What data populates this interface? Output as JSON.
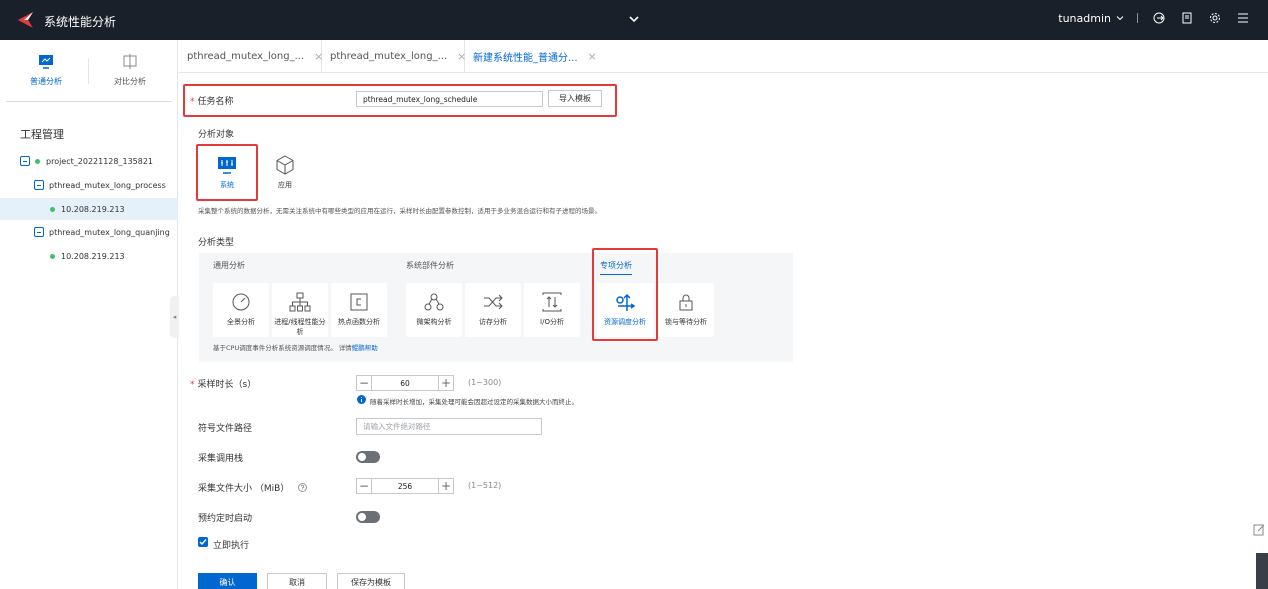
{
  "header": {
    "app_title": "系统性能分析",
    "username": "tunadmin"
  },
  "sidebar": {
    "mode_tabs": [
      {
        "label": "普通分析"
      },
      {
        "label": "对比分析"
      }
    ],
    "project_title": "工程管理",
    "tree": [
      {
        "label": "project_20221128_135821"
      },
      {
        "label": "pthread_mutex_long_process"
      },
      {
        "label": "10.208.219.213"
      },
      {
        "label": "pthread_mutex_long_quanjing"
      },
      {
        "label": "10.208.219.213"
      }
    ]
  },
  "tabs": [
    {
      "label": "pthread_mutex_long_...",
      "close": "×"
    },
    {
      "label": "pthread_mutex_long_...",
      "close": "×"
    },
    {
      "label": "新建系统性能_普通分...",
      "close": "×"
    }
  ],
  "form": {
    "task_name_label": "任务名称",
    "task_name_value": "pthread_mutex_long_schedule",
    "import_template": "导入模板",
    "target_label": "分析对象",
    "targets": [
      {
        "label": "系统"
      },
      {
        "label": "应用"
      }
    ],
    "target_desc": "采集整个系统的数据分析，无需关注系统中有哪些类型的应用在运行，采样时长由配置参数控制，适用于多业务混合运行和有子进程的场景。",
    "type_label": "分析类型",
    "groups": [
      {
        "label": "通用分析"
      },
      {
        "label": "系统部件分析"
      },
      {
        "label": "专项分析"
      }
    ],
    "types": [
      {
        "label": "全景分析"
      },
      {
        "label": "进程/线程性能分析"
      },
      {
        "label": "热点函数分析"
      },
      {
        "label": "微架构分析"
      },
      {
        "label": "访存分析"
      },
      {
        "label": "I/O分析"
      },
      {
        "label": "资源调度分析"
      },
      {
        "label": "锁与等待分析"
      }
    ],
    "type_desc": "基于CPU调度事件分析系统资源调度情况。 详情",
    "type_desc_link": "鲲鹏帮助",
    "sample_duration_label": "采样时长（s）",
    "sample_duration_value": "60",
    "sample_duration_range": "(1~300)",
    "sample_duration_note": "随着采样时长增加，采集处理可能会因超过设定的采集数据大小而终止。",
    "symbol_path_label": "符号文件路径",
    "symbol_path_placeholder": "请输入文件绝对路径",
    "callstack_label": "采集调用栈",
    "file_size_label": "采集文件大小 （MiB）",
    "file_size_value": "256",
    "file_size_range": "(1~512)",
    "schedule_label": "预约定时启动",
    "run_now_label": "立即执行",
    "confirm": "确认",
    "cancel": "取消",
    "save_template": "保存为模板"
  }
}
